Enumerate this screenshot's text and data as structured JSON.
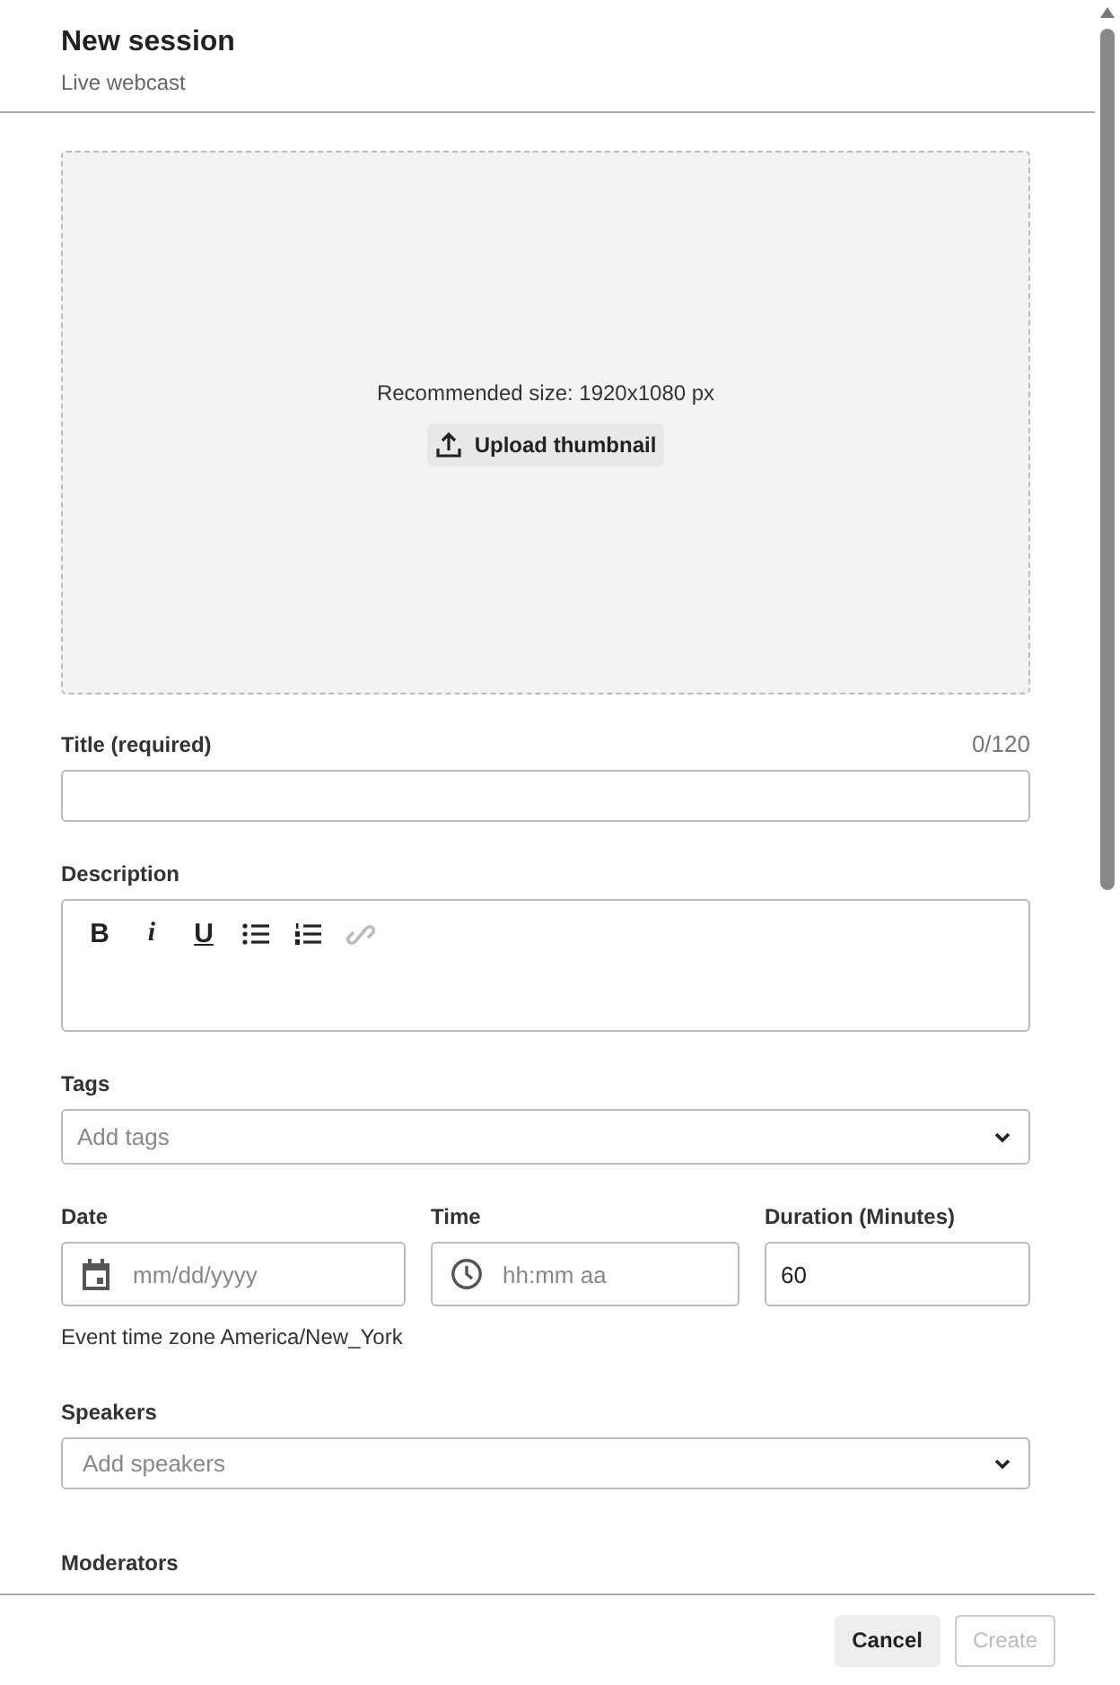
{
  "header": {
    "title": "New session",
    "subtitle": "Live webcast"
  },
  "thumbnail": {
    "hint": "Recommended size: 1920x1080 px",
    "button": "Upload thumbnail"
  },
  "title_field": {
    "label": "Title (required)",
    "counter": "0/120"
  },
  "description": {
    "label": "Description",
    "toolbar": [
      {
        "kind": "bold",
        "label": "B",
        "disabled": false
      },
      {
        "kind": "italic",
        "label": "i",
        "disabled": false
      },
      {
        "kind": "underline",
        "label": "U",
        "disabled": false
      },
      {
        "kind": "bullets",
        "disabled": false
      },
      {
        "kind": "numbers",
        "disabled": false
      },
      {
        "kind": "link",
        "disabled": true
      }
    ]
  },
  "tags": {
    "label": "Tags",
    "placeholder": "Add tags"
  },
  "date": {
    "label": "Date",
    "placeholder": "mm/dd/yyyy"
  },
  "time": {
    "label": "Time",
    "placeholder": "hh:mm aa"
  },
  "duration": {
    "label": "Duration (Minutes)",
    "value": "60"
  },
  "timezone_note": "Event time zone America/New_York",
  "speakers": {
    "label": "Speakers",
    "placeholder": "Add speakers"
  },
  "moderators": {
    "label": "Moderators"
  },
  "buttons": [
    {
      "label": "Cancel",
      "disabled": false
    },
    {
      "label": "Create",
      "disabled": true
    }
  ]
}
